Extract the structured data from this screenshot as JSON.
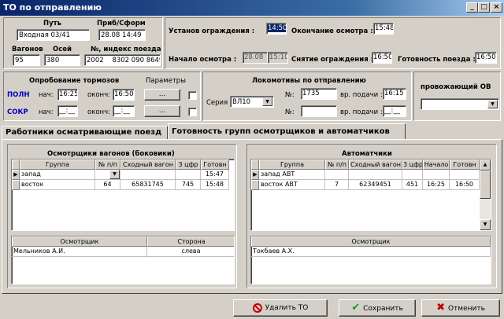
{
  "window": {
    "title": "ТО по отправлению",
    "min": "_",
    "max": "□",
    "close": "×"
  },
  "train": {
    "path_label": "Путь",
    "path_value": "Входная 03/41",
    "arr_label": "Приб/Сформ",
    "arr_value": "28.08 14:49",
    "wagons_label": "Вагонов",
    "wagons_value": "95",
    "axles_label": "Осей",
    "axles_value": "380",
    "index_label": "№, индекс поезда",
    "num_value": "2002",
    "index_value": "8302 090 8649"
  },
  "times": {
    "fence_label": "Установ ограждения :",
    "fence_value": "14:50",
    "insp_end_label": "Окончание осмотра :",
    "insp_end_value": "15:48",
    "insp_start_label": "Начало осмотра :",
    "insp_start_date": "28.08",
    "insp_start_time": "15:10",
    "fence_off_label": "Снятие ограждения :",
    "fence_off_value": "16:50",
    "ready_label": "Готовность поезда :",
    "ready_value": "16:50"
  },
  "brakes": {
    "title": "Опробование тормозов",
    "params_label": "Параметры",
    "full": "ПОЛН",
    "short": "СОКР",
    "start_label": "нач:",
    "end_label": "оконч:",
    "full_start": "16:25",
    "full_end": "16:50",
    "short_start": "__:__",
    "short_end": "__:__",
    "btn": "..."
  },
  "locos": {
    "title": "Локомотивы по отправлению",
    "series_label": "Серия :",
    "series_value": "ВЛ10",
    "num_label": "№:",
    "num1": "1735",
    "num2": "",
    "supply_label": "вр. подачи :",
    "supply1": "16:15",
    "supply2": "__:__"
  },
  "escort": {
    "title": "провожающий ОВ",
    "value": ""
  },
  "tabs": [
    {
      "label": "Работники осматривающие поезд"
    },
    {
      "label": "Готовность групп осмотрщиков и автоматчиков"
    }
  ],
  "inspectors": {
    "title": "Осмотрщики вагонов (боковики)",
    "headers": [
      "Группа",
      "№ п/п",
      "Сходный вагон",
      "3 цфр",
      "Готовн"
    ],
    "rows": [
      [
        "запад",
        "",
        "",
        "",
        "15:47"
      ],
      [
        "восток",
        "64",
        "65831745",
        "745",
        "15:48"
      ]
    ],
    "sub_headers": [
      "Осмотрщик",
      "Сторона"
    ],
    "sub_rows": [
      [
        "Мельников А.И.",
        "слева"
      ]
    ]
  },
  "auto": {
    "title": "Автоматчики",
    "headers": [
      "Группа",
      "№ п/п",
      "Сходный вагон",
      "3 цфр",
      "Начало",
      "Готовн"
    ],
    "rows": [
      [
        "запад АВТ",
        "",
        "",
        "",
        "",
        ""
      ],
      [
        "восток АВТ",
        "7",
        "62349451",
        "451",
        "16:25",
        "16:50"
      ]
    ],
    "sub_headers": [
      "Осмотрщик"
    ],
    "sub_rows": [
      [
        "Токбаев А.Х."
      ]
    ]
  },
  "buttons": {
    "delete": "Удалить ТО",
    "save": "Сохранить",
    "cancel": "Отменить"
  },
  "colors": {
    "title": "#0a246a",
    "delete_icon": "#c00000",
    "save_icon": "#1a9a1a",
    "cancel_icon": "#c00000",
    "brake_label": "#0000c0"
  }
}
